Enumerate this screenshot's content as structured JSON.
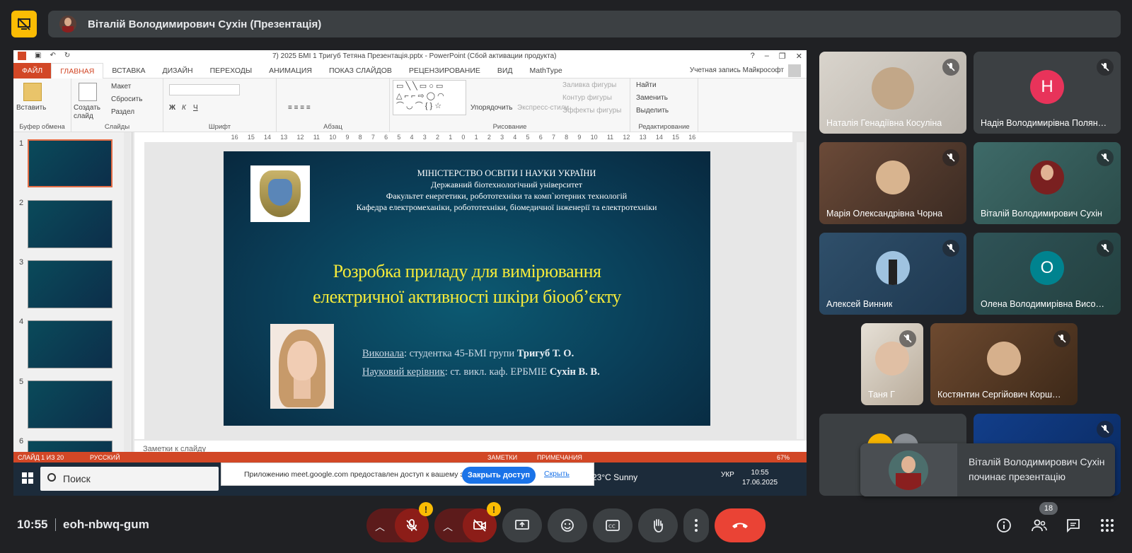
{
  "header": {
    "presenter_title": "Віталій Володимирович Сухін (Презентація)"
  },
  "ppt": {
    "doc_title": "7) 2025 БМІ 1 Тригуб Тетяна Презентація.pptx - PowerPoint (Сбой активации продукта)",
    "tabs": [
      "ФАЙЛ",
      "ГЛАВНАЯ",
      "ВСТАВКА",
      "ДИЗАЙН",
      "ПЕРЕХОДЫ",
      "АНИМАЦИЯ",
      "ПОКАЗ СЛАЙДОВ",
      "РЕЦЕНЗИРОВАНИЕ",
      "ВИД",
      "MathType"
    ],
    "account": "Учетная запись Майкрософт",
    "ribbon": {
      "paste": "Вставить",
      "new_slide": "Создать слайд",
      "layout": "Макет",
      "reset": "Сбросить",
      "section": "Раздел",
      "arrange": "Упорядочить",
      "quick_styles": "Экспресс-стили",
      "fill": "Заливка фигуры",
      "outline": "Контур фигуры",
      "effects": "Эффекты фигуры",
      "find": "Найти",
      "replace": "Заменить",
      "select": "Выделить",
      "groups": [
        "Буфер обмена",
        "Слайды",
        "Шрифт",
        "Абзац",
        "Рисование",
        "Редактирование"
      ]
    },
    "ruler_ticks": [
      "16",
      "15",
      "14",
      "13",
      "12",
      "11",
      "10",
      "9",
      "8",
      "7",
      "6",
      "5",
      "4",
      "3",
      "2",
      "1",
      "0",
      "1",
      "2",
      "3",
      "4",
      "5",
      "6",
      "7",
      "8",
      "9",
      "10",
      "11",
      "12",
      "13",
      "14",
      "15",
      "16"
    ],
    "thumb_numbers": [
      "1",
      "2",
      "3",
      "4",
      "5",
      "6"
    ],
    "slide": {
      "ministry": "МІНІСТЕРСТВО ОСВІТИ І НАУКИ УКРАЇНИ",
      "university": "Державний біотехнологічний університет",
      "faculty": "Факультет енергетики, робототехніки та комп`ютерних технологій",
      "department": "Кафедра електромеханіки,  робототехніки, біомедичної інженерії  та електротехніки",
      "title_line1": "Розробка приладу для вимірювання",
      "title_line2": "електричної активності шкіри біооб’єкту",
      "done_by_label": "Виконала",
      "done_by_text": ": студентка 45-БМІ групи ",
      "done_by_name": "Тригуб Т. О.",
      "supervisor_label": "Науковий керівник",
      "supervisor_text": ": ст. викл. каф. ЕРБМІЕ ",
      "supervisor_name": "Сухін В. В."
    },
    "notes": "Заметки к слайду",
    "status": {
      "slide_num": "СЛАЙД 1 ИЗ 20",
      "lang": "РУССКИЙ",
      "notes_btn": "ЗАМЕТКИ",
      "comments_btn": "ПРИМЕЧАНИЯ",
      "zoom": "67%"
    }
  },
  "taskbar": {
    "search": "Поиск",
    "share_message": "Приложению meet.google.com предоставлен доступ к вашему экрану.",
    "stop_sharing": "Закрыть доступ",
    "hide": "Скрыть",
    "weather": "23°C  Sunny",
    "lang": "УКР",
    "time": "10:55",
    "date": "17.06.2025"
  },
  "participants": [
    {
      "name": "Наталія Генадіївна Косуліна",
      "type": "photo",
      "muted": true
    },
    {
      "name": "Надія Володимирівна Полян…",
      "type": "letter",
      "letter": "Н",
      "color": "#e8335a",
      "muted": true
    },
    {
      "name": "Марія Олександрівна Чорна",
      "type": "photo",
      "muted": true
    },
    {
      "name": "Віталій Володимирович Сухін",
      "type": "photo",
      "muted": true
    },
    {
      "name": "Алексей Винник",
      "type": "photo",
      "muted": true
    },
    {
      "name": "Олена Володимирівна Висо…",
      "type": "letter",
      "letter": "О",
      "color": "#00838f",
      "muted": true
    },
    {
      "name": "Таня Г",
      "type": "photo",
      "muted": true
    },
    {
      "name": "Костянтин Сергійович Корш…",
      "type": "photo",
      "muted": true
    }
  ],
  "toast": {
    "message": "Віталій Володимирович Сухін починає презентацію"
  },
  "bottom": {
    "time": "10:55",
    "meeting_code": "eoh-nbwq-gum",
    "participant_count": "18"
  },
  "colors": {
    "meet_bg": "#202124",
    "tile_bg": "#3c4043",
    "hangup": "#ea4335",
    "ppt_accent": "#d24726",
    "slide_title": "#f4ea3a"
  }
}
